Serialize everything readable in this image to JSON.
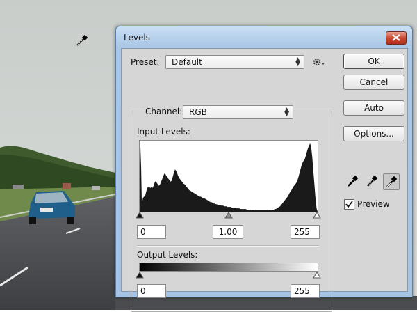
{
  "dialog": {
    "title": "Levels",
    "preset_label": "Preset:",
    "preset_value": "Default",
    "channel_label": "Channel:",
    "channel_value": "RGB",
    "input_levels_label": "Input Levels:",
    "input_black": "0",
    "input_gamma": "1.00",
    "input_white": "255",
    "output_levels_label": "Output Levels:",
    "output_black": "0",
    "output_white": "255",
    "buttons": {
      "ok": "OK",
      "cancel": "Cancel",
      "auto": "Auto",
      "options": "Options..."
    },
    "preview_label": "Preview",
    "preview_checked": true
  },
  "histogram": [
    0,
    95,
    10,
    20,
    22,
    23,
    29,
    35,
    36,
    36,
    35,
    36,
    35,
    38,
    43,
    45,
    42,
    40,
    38,
    40,
    44,
    48,
    52,
    56,
    55,
    52,
    50,
    48,
    46,
    44,
    46,
    52,
    58,
    62,
    60,
    56,
    52,
    49,
    47,
    45,
    43,
    41,
    40,
    38,
    36,
    34,
    32,
    31,
    30,
    29,
    28,
    27,
    26,
    25,
    24,
    23,
    22,
    22,
    21,
    20,
    20,
    19,
    18,
    17,
    16,
    15,
    14,
    14,
    13,
    12,
    12,
    11,
    11,
    10,
    10,
    10,
    9,
    9,
    9,
    8,
    8,
    8,
    7,
    7,
    7,
    7,
    6,
    6,
    6,
    6,
    5,
    5,
    5,
    5,
    4,
    4,
    4,
    4,
    4,
    4,
    3,
    3,
    3,
    3,
    3,
    3,
    3,
    2,
    2,
    2,
    2,
    2,
    2,
    2,
    2,
    2,
    2,
    2,
    2,
    2,
    2,
    3,
    3,
    3,
    3,
    3,
    4,
    4,
    5,
    6,
    7,
    8,
    10,
    12,
    14,
    16,
    18,
    20,
    22,
    25,
    28,
    30,
    33,
    36,
    38,
    40,
    42,
    45,
    50,
    56,
    62,
    68,
    72,
    75,
    77,
    82,
    88,
    93,
    97,
    100,
    95,
    80,
    60,
    40,
    20,
    5,
    0
  ],
  "colors": {
    "histogram_fill": "#1a1a1a",
    "dialog_body": "#d6d6d6",
    "title_bar": "#a9c6e6",
    "close_button": "#c9472f"
  },
  "icons": {
    "cursor": "eyedropper-cursor-icon",
    "preset_options": "gear-icon",
    "eyedroppers": [
      "black-eyedropper-icon",
      "gray-eyedropper-icon",
      "white-eyedropper-icon"
    ]
  }
}
